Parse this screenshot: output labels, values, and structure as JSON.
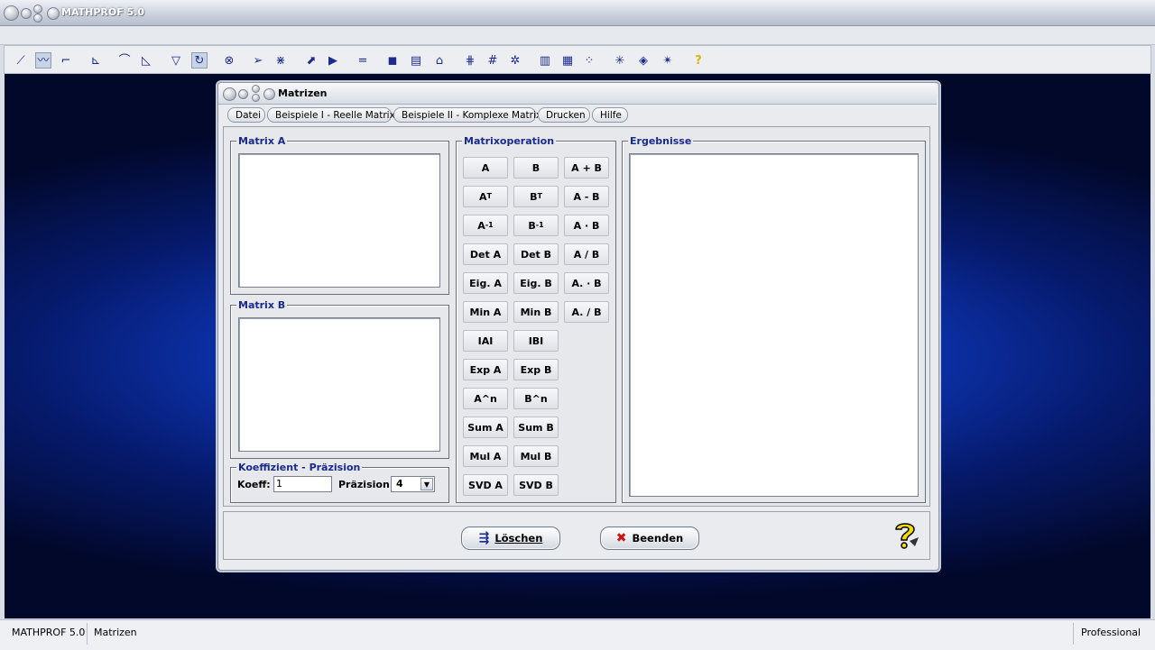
{
  "window": {
    "title": "MATHPROF 5.0"
  },
  "dialog": {
    "title": "Matrizen",
    "menu": [
      "Datei",
      "Beispiele I - Reelle Matrix",
      "Beispiele II - Komplexe Matrix",
      "Drucken",
      "Hilfe"
    ]
  },
  "matrix_a": {
    "legend": "Matrix A",
    "value": ""
  },
  "matrix_b": {
    "legend": "Matrix B",
    "value": ""
  },
  "operations": {
    "legend": "Matrixoperation",
    "col1": [
      "A",
      "AT",
      "A-1",
      "Det A",
      "Eig. A",
      "Min A",
      "IAI",
      "Exp A",
      "A^n",
      "Sum A",
      "Mul A",
      "SVD A"
    ],
    "col2": [
      "B",
      "BT",
      "B-1",
      "Det B",
      "Eig. B",
      "Min B",
      "IBI",
      "Exp B",
      "B^n",
      "Sum B",
      "Mul B",
      "SVD B"
    ],
    "col3": [
      "A + B",
      "A - B",
      "A · B",
      "A / B",
      "A. · B",
      "A. / B"
    ]
  },
  "results": {
    "legend": "Ergebnisse",
    "value": ""
  },
  "precision": {
    "legend": "Koeffizient - Präzision",
    "koeff_label": "Koeff:",
    "koeff_value": "1",
    "prec_label": "Präzision:",
    "prec_value": "4"
  },
  "footer": {
    "clear_label": "Löschen",
    "exit_label": "Beenden"
  },
  "statusbar": {
    "app": "MATHPROF 5.0",
    "module": "Matrizen",
    "edition": "Professional"
  },
  "icons": {
    "toolbar_accent": "#1b2b8c",
    "exit_icon_color": "#d01010",
    "help_color": "#f0d800"
  }
}
